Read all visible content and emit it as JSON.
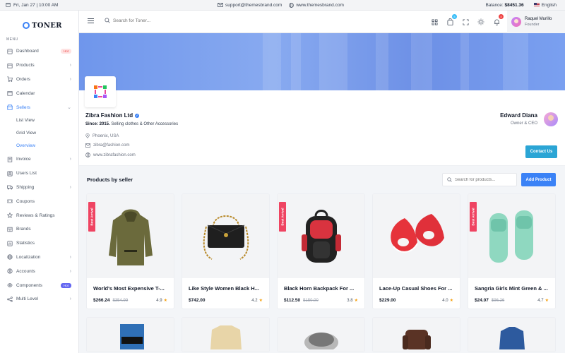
{
  "topbar": {
    "datetime": "Fri, Jan 27 | 10:00 AM",
    "email": "support@themesbrand.com",
    "website": "www.themesbrand.com",
    "balance_label": "Balance:",
    "balance_value": "$8451.36",
    "language": "English"
  },
  "brand": {
    "name": "TONER"
  },
  "sidebar": {
    "menu_title": "MENU",
    "items": [
      {
        "label": "Dashboard",
        "icon": "dashboard-icon",
        "badge": "Hot"
      },
      {
        "label": "Products",
        "icon": "products-icon",
        "chevron": true
      },
      {
        "label": "Orders",
        "icon": "cart-icon",
        "chevron": true
      },
      {
        "label": "Calendar",
        "icon": "calendar-icon"
      },
      {
        "label": "Sellers",
        "icon": "sellers-icon",
        "chevron": true,
        "active": true
      }
    ],
    "sub_items": [
      "List View",
      "Grid View",
      "Overview"
    ],
    "items_after": [
      {
        "label": "Invoice",
        "icon": "invoice-icon",
        "chevron": true
      },
      {
        "label": "Users List",
        "icon": "users-icon"
      },
      {
        "label": "Shipping",
        "icon": "shipping-icon",
        "chevron": true
      },
      {
        "label": "Coupons",
        "icon": "coupon-icon"
      },
      {
        "label": "Reviews & Ratings",
        "icon": "star-icon"
      },
      {
        "label": "Brands",
        "icon": "brands-icon"
      },
      {
        "label": "Statistics",
        "icon": "statistics-icon"
      },
      {
        "label": "Localization",
        "icon": "globe-icon",
        "chevron": true
      },
      {
        "label": "Accounts",
        "icon": "account-icon",
        "chevron": true
      },
      {
        "label": "Components",
        "icon": "components-icon",
        "badge": "Hot"
      },
      {
        "label": "Multi Level",
        "icon": "share-icon",
        "chevron": true
      }
    ]
  },
  "header": {
    "search_placeholder": "Search for Toner...",
    "cart_count": "5",
    "notification_count": "4",
    "user_name": "Raquel Murillo",
    "user_role": "Founder"
  },
  "seller": {
    "name": "Zibra Fashion Ltd",
    "since_label": "Since: 2015.",
    "since_text": "Selling clothes & Other Accessories",
    "location": "Phoenix, USA",
    "email": "zibra@fashion.com",
    "website": "www.zibrafashion.com",
    "owner_name": "Edward Diana",
    "owner_role": "Owner & CEO",
    "contact_label": "Contact Us"
  },
  "products_section": {
    "title": "Products by seller",
    "search_placeholder": "Search for products...",
    "add_label": "Add Product"
  },
  "products": [
    {
      "name": "World's Most Expensive T-...",
      "price": "$266.24",
      "old_price": "$354.99",
      "rating": "4.9",
      "ribbon": "Best Arrival",
      "image": "hoodie"
    },
    {
      "name": "Like Style Women Black H...",
      "price": "$742.00",
      "old_price": "",
      "rating": "4.2",
      "ribbon": "",
      "image": "handbag"
    },
    {
      "name": "Black Horn Backpack For ...",
      "price": "$112.50",
      "old_price": "$150.00",
      "rating": "3.8",
      "ribbon": "Best Arrival",
      "image": "backpack"
    },
    {
      "name": "Lace-Up Casual Shoes For ...",
      "price": "$229.00",
      "old_price": "",
      "rating": "4.0",
      "ribbon": "",
      "image": "shoes"
    },
    {
      "name": "Sangria Girls Mint Green & ...",
      "price": "$24.07",
      "old_price": "$96.26",
      "rating": "4.7",
      "ribbon": "Best Arrival",
      "image": "slippers"
    }
  ],
  "colors": {
    "accent": "#3b82f6",
    "contact": "#2ba5d5",
    "ribbon": "#ef4462",
    "star": "#f59e0b"
  }
}
